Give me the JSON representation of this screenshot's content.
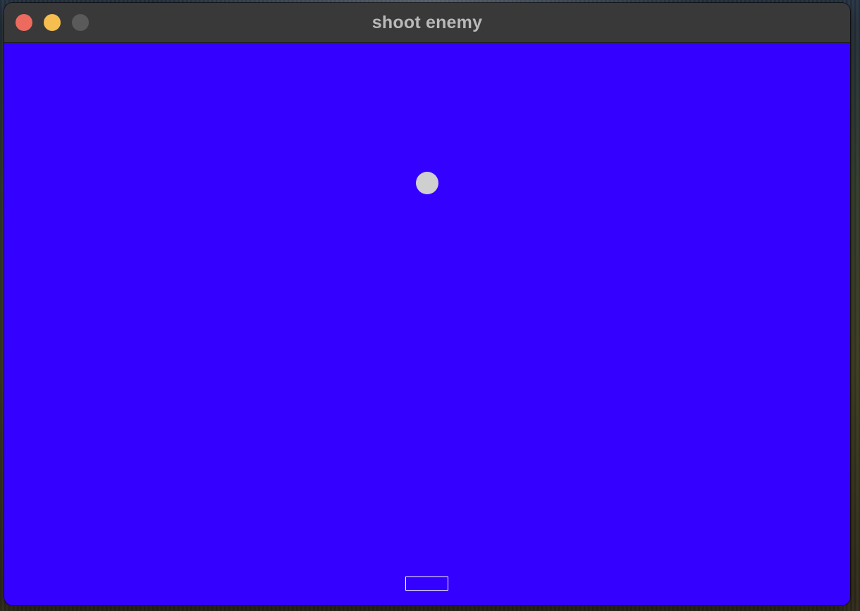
{
  "window": {
    "title": "shoot enemy",
    "controls": {
      "close_color": "#ed6a5e",
      "minimize_color": "#f5be4f",
      "zoom_color": "#5a5a5a"
    }
  },
  "game": {
    "background_color": "#3400ff",
    "enemy": {
      "shape": "circle",
      "color": "#cfcfcf"
    },
    "player": {
      "shape": "rectangle-outline",
      "color": "#ffffff"
    }
  }
}
